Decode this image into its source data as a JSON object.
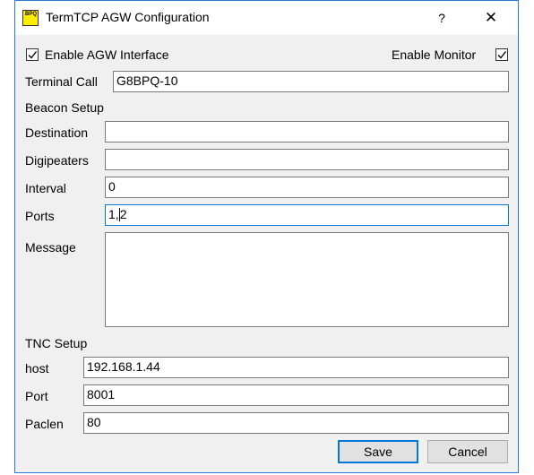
{
  "window": {
    "title": "TermTCP AGW Configuration",
    "icon_text": "BPQ",
    "help_glyph": "?",
    "close_glyph": "✕"
  },
  "agw": {
    "enable_label": "Enable AGW Interface",
    "enable_checked": true,
    "monitor_label": "Enable Monitor",
    "monitor_checked": true,
    "terminal_call_label": "Terminal Call",
    "terminal_call_value": "G8BPQ-10"
  },
  "beacon": {
    "section_label": "Beacon Setup",
    "destination_label": "Destination",
    "destination_value": "",
    "digipeaters_label": "Digipeaters",
    "digipeaters_value": "",
    "interval_label": "Interval",
    "interval_value": "0",
    "ports_label": "Ports",
    "ports_value_before": "1,",
    "ports_value_after": "2",
    "message_label": "Message",
    "message_value": ""
  },
  "tnc": {
    "section_label": "TNC Setup",
    "host_label": "host",
    "host_value": "192.168.1.44",
    "port_label": "Port",
    "port_value": "8001",
    "paclen_label": "Paclen",
    "paclen_value": "80"
  },
  "buttons": {
    "save": "Save",
    "cancel": "Cancel"
  },
  "colors": {
    "accent": "#0078d7",
    "window_border": "#2b79d7",
    "dialog_bg": "#f0f0f0",
    "icon_bg": "#ffee00"
  }
}
